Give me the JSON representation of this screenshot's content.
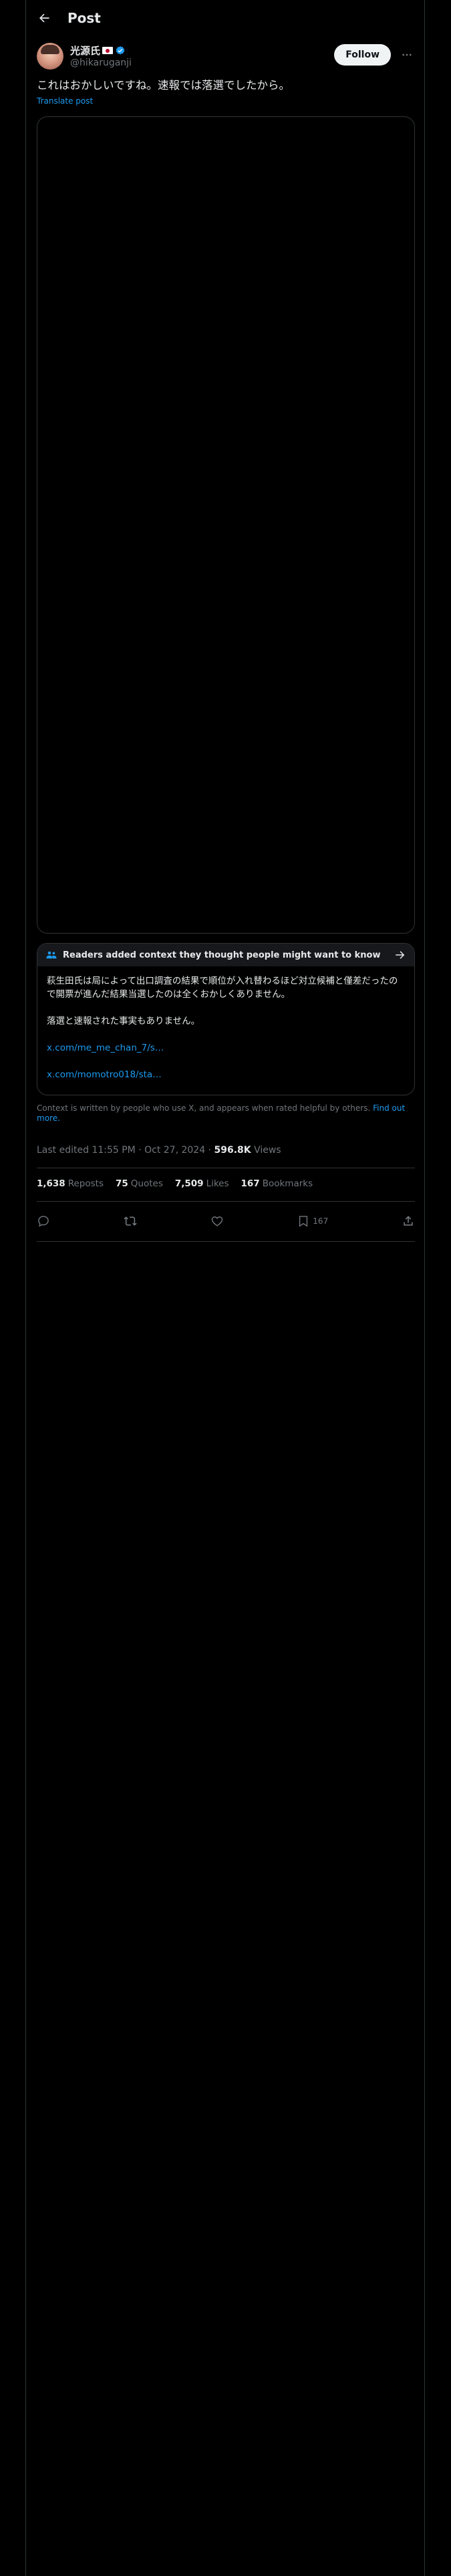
{
  "header": {
    "title": "Post"
  },
  "author": {
    "display_name": "光源氏",
    "handle": "@hikaruganji",
    "follow_label": "Follow"
  },
  "post": {
    "text": "これはおかしいですね。速報では落選でしたから。",
    "translate_label": "Translate post"
  },
  "community_note": {
    "title": "Readers added context they thought people might want to know",
    "paragraphs": [
      "萩生田氏は局によって出口調査の結果で順位が入れ替わるほど対立候補と僅差だったので開票が進んだ結果当選したのは全くおかしくありません。",
      "落選と速報された事実もありません。"
    ],
    "links": [
      "x.com/me_me_chan_7/s…",
      "x.com/momotro018/sta…"
    ],
    "footer_text": "Context is written by people who use X, and appears when rated helpful by others.",
    "footer_link": "Find out more."
  },
  "meta": {
    "timestamp": "Last edited 11:55 PM · Oct 27, 2024 ·",
    "views_count": "596.8K",
    "views_label": "Views"
  },
  "stats": {
    "reposts_count": "1,638",
    "reposts_label": "Reposts",
    "quotes_count": "75",
    "quotes_label": "Quotes",
    "likes_count": "7,509",
    "likes_label": "Likes",
    "bookmarks_count": "167",
    "bookmarks_label": "Bookmarks"
  },
  "actions": {
    "bookmark_count": "167"
  },
  "icons": {
    "back": "arrow-left-icon",
    "verified": "verified-badge-icon",
    "more": "more-horizontal-icon",
    "note": "people-icon",
    "note_arrow": "arrow-right-icon",
    "reply": "reply-icon",
    "repost": "repost-icon",
    "like": "heart-icon",
    "bookmark": "bookmark-icon",
    "share": "share-icon"
  },
  "colors": {
    "background": "#000000",
    "accent": "#1d9bf0",
    "muted": "#71767b",
    "border": "#2f3336",
    "verified": "#1d9bf0"
  }
}
